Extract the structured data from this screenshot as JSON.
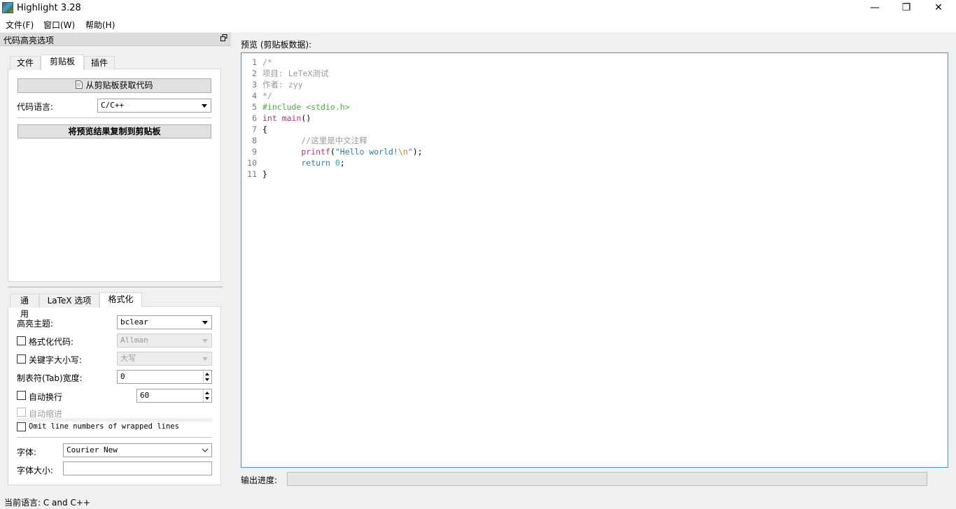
{
  "window": {
    "title": "Highlight 3.28",
    "controls": {
      "minimize": "—",
      "maximize": "❐",
      "close": "✕"
    }
  },
  "menu": [
    "文件(F)",
    "窗口(W)",
    "帮助(H)"
  ],
  "dock": {
    "title": "代码高亮选项",
    "float_icon": "float-icon"
  },
  "top_tabs": [
    "文件",
    "剪贴板",
    "插件"
  ],
  "top_active_tab": "剪贴板",
  "clipboard": {
    "get_code_button": "从剪贴板获取代码",
    "language_label": "代码语言:",
    "language_value": "C/C++",
    "copy_button": "将预览结果复制到剪贴板"
  },
  "bottom_tabs": [
    "通用",
    "LaTeX 选项",
    "格式化"
  ],
  "bottom_active_tab": "格式化",
  "format": {
    "theme_label": "高亮主题:",
    "theme_value": "bclear",
    "format_code_label": "格式化代码:",
    "format_code_value": "Allman",
    "keyword_case_label": "关键字大小写:",
    "keyword_case_value": "大写",
    "tab_width_label": "制表符(Tab)宽度:",
    "tab_width_value": "0",
    "wrap_label": "自动换行",
    "wrap_value": "60",
    "auto_indent_label": "自动缩进",
    "omit_label": "Omit line numbers of wrapped lines",
    "font_label": "字体:",
    "font_value": "Courier New",
    "font_size_label": "字体大小:",
    "font_size_value": ""
  },
  "preview": {
    "label": "预览 (剪贴板数据):",
    "code_lines": [
      {
        "num": "1",
        "segments": [
          {
            "text": "/*",
            "cls": "c-comment"
          }
        ]
      },
      {
        "num": "2",
        "segments": [
          {
            "text": "项目: LeTeX测试",
            "cls": "c-comment"
          }
        ]
      },
      {
        "num": "3",
        "segments": [
          {
            "text": "作者: zyy",
            "cls": "c-comment"
          }
        ]
      },
      {
        "num": "4",
        "segments": [
          {
            "text": "*/",
            "cls": "c-comment"
          }
        ]
      },
      {
        "num": "5",
        "segments": [
          {
            "text": "#include <stdio.h>",
            "cls": "c-pre"
          }
        ]
      },
      {
        "num": "6",
        "segments": [
          {
            "text": "int",
            "cls": "c-kw"
          },
          {
            "text": " main",
            "cls": "c-func"
          },
          {
            "text": "()",
            "cls": ""
          }
        ]
      },
      {
        "num": "7",
        "segments": [
          {
            "text": "{",
            "cls": ""
          }
        ]
      },
      {
        "num": "8",
        "segments": [
          {
            "text": "        //这里是中文注释",
            "cls": "c-comment"
          }
        ]
      },
      {
        "num": "9",
        "segments": [
          {
            "text": "        printf",
            "cls": "c-func"
          },
          {
            "text": "(",
            "cls": ""
          },
          {
            "text": "\"Hello world!",
            "cls": "c-str"
          },
          {
            "text": "\\n",
            "cls": "c-esc"
          },
          {
            "text": "\"",
            "cls": "c-str"
          },
          {
            "text": ");",
            "cls": ""
          }
        ]
      },
      {
        "num": "10",
        "segments": [
          {
            "text": "        return",
            "cls": "c-ret"
          },
          {
            "text": " ",
            "cls": ""
          },
          {
            "text": "0",
            "cls": "c-num"
          },
          {
            "text": ";",
            "cls": ""
          }
        ]
      },
      {
        "num": "11",
        "segments": [
          {
            "text": "}",
            "cls": ""
          }
        ]
      }
    ]
  },
  "progress": {
    "label": "输出进度:",
    "fraction": 0
  },
  "status": {
    "text": "当前语言: C and C++"
  },
  "colors": {
    "accent_border": "#4a90b8",
    "preprocessor": "#4cae3e",
    "keyword": "#b03a80",
    "string": "#2a7fb0",
    "escape": "#e07a1e",
    "number": "#2aa89a",
    "comment": "#9a9a9a"
  }
}
